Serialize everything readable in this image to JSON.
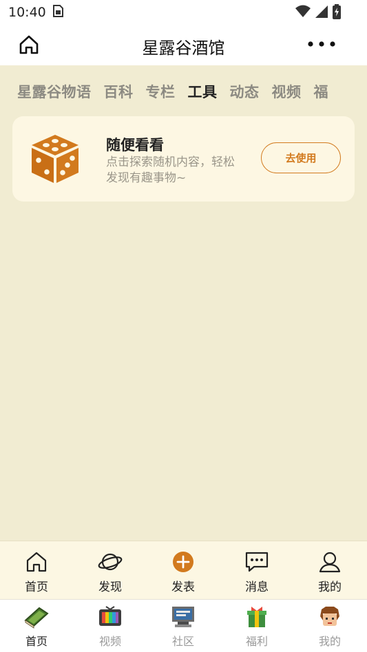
{
  "status_bar": {
    "time": "10:40"
  },
  "nav": {
    "title": "星露谷酒馆"
  },
  "tabs": [
    {
      "label": "星露谷物语"
    },
    {
      "label": "百科"
    },
    {
      "label": "专栏"
    },
    {
      "label": "工具",
      "active": true
    },
    {
      "label": "动态"
    },
    {
      "label": "视频"
    },
    {
      "label": "福"
    }
  ],
  "tool_card": {
    "title": "随便看看",
    "description": "点击探索随机内容，轻松发现有趣事物~",
    "button_label": "去使用"
  },
  "sub_nav": [
    {
      "label": "首页",
      "icon": "home-outline-icon"
    },
    {
      "label": "发现",
      "icon": "planet-icon"
    },
    {
      "label": "发表",
      "icon": "plus-circle-icon"
    },
    {
      "label": "消息",
      "icon": "message-icon"
    },
    {
      "label": "我的",
      "icon": "person-icon"
    }
  ],
  "tab_bar": [
    {
      "label": "首页",
      "icon": "book-pixel-icon",
      "active": true
    },
    {
      "label": "视频",
      "icon": "tv-pixel-icon"
    },
    {
      "label": "社区",
      "icon": "computer-pixel-icon"
    },
    {
      "label": "福利",
      "icon": "gift-pixel-icon"
    },
    {
      "label": "我的",
      "icon": "avatar-pixel-icon"
    }
  ],
  "colors": {
    "accent": "#d27a1e",
    "background": "#f1ecd2",
    "card": "#fdf7e3"
  }
}
